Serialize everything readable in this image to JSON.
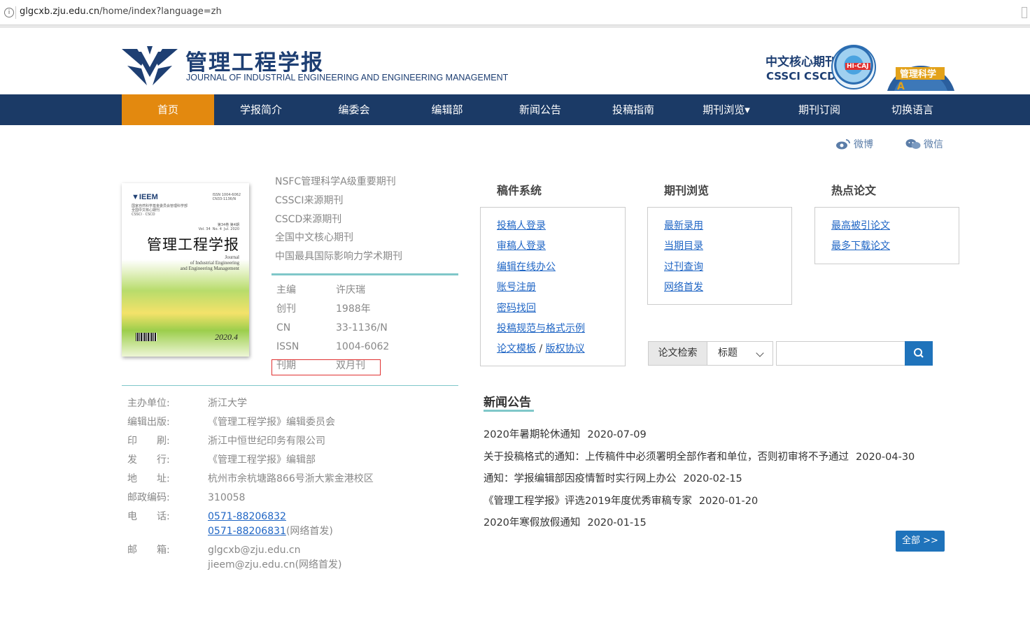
{
  "browser": {
    "url_host": "glgcxb.zju.edu.cn",
    "url_path": "/home/index?language=zh"
  },
  "header": {
    "title": "管理工程学报",
    "subtitle": "JOURNAL OF INDUSTRIAL ENGINEERING AND ENGINEERING MANAGEMENT",
    "core_label": "中文核心期刊",
    "core_sub": "CSSCI  CSCD",
    "badge1_text": "HI-CAJ",
    "badge2_text": "管理科学"
  },
  "nav": {
    "items": [
      "首页",
      "学报简介",
      "编委会",
      "编辑部",
      "新闻公告",
      "投稿指南",
      "期刊浏览▾",
      "期刊订阅",
      "切换语言"
    ]
  },
  "social": {
    "weibo": "微博",
    "weixin": "微信"
  },
  "cover": {
    "brand": "IEEM",
    "title": "管理工程学报",
    "issn": "ISSN 1004-6062\nCN33-1136/N",
    "vol": "第34卷 第4期\nVol. 34  No. 4  Jul. 2020",
    "en": "Journal\nof Industrial Engineering\nand Engineering Management",
    "year": "2020.4"
  },
  "tags": [
    "NSFC管理科学A级重要期刊",
    "CSSCI来源期刊",
    "CSCD来源期刊",
    "全国中文核心期刊",
    "中国最具国际影响力学术期刊"
  ],
  "meta": [
    {
      "k": "主编",
      "v": "许庆瑞"
    },
    {
      "k": "创刊",
      "v": "1988年"
    },
    {
      "k": "CN",
      "v": "33-1136/N"
    },
    {
      "k": "ISSN",
      "v": "1004-6062"
    },
    {
      "k": "刊期",
      "v": "双月刊"
    }
  ],
  "info": {
    "sponsor_k": "主办单位:",
    "sponsor_v": "浙江大学",
    "editor_k": "编辑出版:",
    "editor_v": "《管理工程学报》编辑委员会",
    "print_k": "印　　刷:",
    "print_v": "浙江中恒世纪印务有限公司",
    "issue_k": "发　　行:",
    "issue_v": "《管理工程学报》编辑部",
    "addr_k": "地　　址:",
    "addr_v": "杭州市余杭塘路866号浙大紫金港校区",
    "post_k": "邮政编码:",
    "post_v": "310058",
    "tel_k": "电　　话:",
    "tel1": "0571-88206832",
    "tel2": "0571-88206831",
    "tel2_note": "(网络首发)",
    "mail_k": "邮　　箱:",
    "mail1": "glgcxb@zju.edu.cn",
    "mail2": "jieem@zju.edu.cn(网络首发)"
  },
  "manuscript": {
    "title": "稿件系统",
    "links": [
      "投稿人登录",
      "审稿人登录",
      "编辑在线办公",
      "账号注册",
      "密码找回",
      "投稿规范与格式示例"
    ],
    "template": "论文模板",
    "slash": "/",
    "agreement": "版权协议"
  },
  "browse": {
    "title": "期刊浏览",
    "links": [
      "最新录用",
      "当期目录",
      "过刊查询",
      "网络首发"
    ]
  },
  "hot": {
    "title": "热点论文",
    "links": [
      "最高被引论文",
      "最多下载论文"
    ]
  },
  "search": {
    "label": "论文检索",
    "field": "标题",
    "value": ""
  },
  "news": {
    "title": "新闻公告",
    "items": [
      {
        "t": "2020年暑期轮休通知",
        "d": "2020-07-09"
      },
      {
        "t": "关于投稿格式的通知：上传稿件中必须署明全部作者和单位，否则初审将不予通过",
        "d": "2020-04-30"
      },
      {
        "t": "通知：学报编辑部因疫情暂时实行网上办公",
        "d": "2020-02-15"
      },
      {
        "t": "《管理工程学报》评选2019年度优秀审稿专家",
        "d": "2020-01-20"
      },
      {
        "t": "2020年寒假放假通知",
        "d": "2020-01-15"
      }
    ],
    "more": "全部 >>"
  }
}
